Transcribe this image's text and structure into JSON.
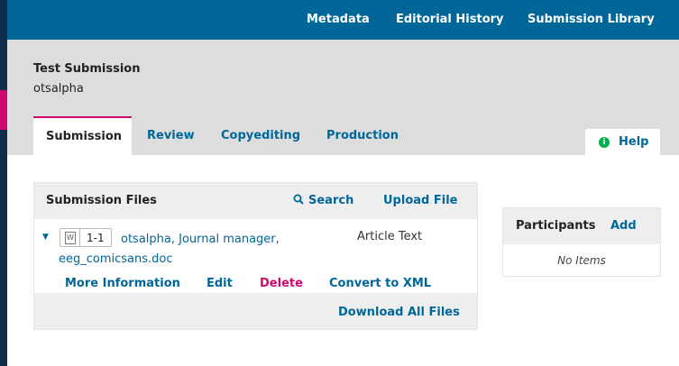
{
  "topnav": {
    "items": [
      "Metadata",
      "Editorial History",
      "Submission Library"
    ]
  },
  "submission": {
    "title": "Test Submission",
    "author": "otsalpha"
  },
  "tabs": {
    "active": "Submission",
    "items": [
      "Review",
      "Copyediting",
      "Production"
    ]
  },
  "help": {
    "icon": "info-icon",
    "label": "Help"
  },
  "files_panel": {
    "title": "Submission Files",
    "search_label": "Search",
    "upload_label": "Upload File",
    "file": {
      "type_icon": "word-document-icon",
      "type_letter": "W",
      "number": "1-1",
      "name": "otsalpha, Journal manager, eeg_comicsans.doc",
      "genre": "Article Text"
    },
    "actions": [
      "More Information",
      "Edit",
      "Delete",
      "Convert to XML"
    ],
    "download_all_label": "Download All Files"
  },
  "participants": {
    "title": "Participants",
    "add_label": "Add",
    "empty_text": "No Items"
  },
  "colors": {
    "brand_blue": "#006798",
    "accent_pink": "#d00a6c",
    "help_green": "#00b24e",
    "rail_dark": "#0d2d4a"
  }
}
